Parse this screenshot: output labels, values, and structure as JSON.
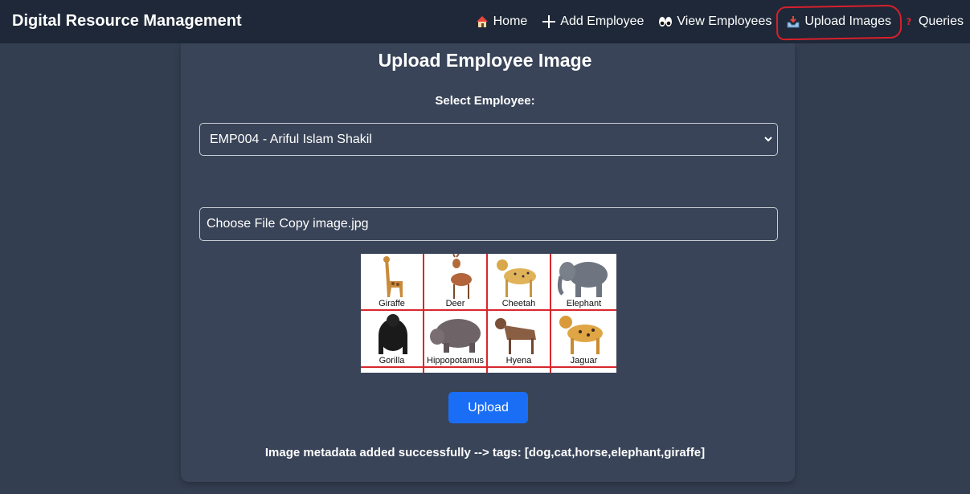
{
  "navbar": {
    "brand": "Digital Resource Management",
    "links": [
      {
        "label": "Home",
        "icon": "house-icon"
      },
      {
        "label": "Add Employee",
        "icon": "plus-icon"
      },
      {
        "label": "View Employees",
        "icon": "eyes-icon"
      },
      {
        "label": "Upload Images",
        "icon": "inbox-tray-icon",
        "active": true
      },
      {
        "label": "Queries",
        "icon": "question-icon"
      }
    ]
  },
  "form": {
    "title": "Upload Employee Image",
    "select_label": "Select Employee:",
    "selected_employee": "EMP004 - Ariful Islam Shakil",
    "file_button_label": "Choose File",
    "file_name": "Copy image.jpg",
    "upload_label": "Upload"
  },
  "preview": {
    "cells": [
      "Giraffe",
      "Deer",
      "Cheetah",
      "Elephant",
      "Gorilla",
      "Hippopotamus",
      "Hyena",
      "Jaguar"
    ]
  },
  "status": "Image metadata added successfully --> tags: [dog,cat,horse,elephant,giraffe]",
  "colors": {
    "page_bg": "#343e51",
    "navbar_bg": "#1e2838",
    "primary": "#1a6ef5",
    "annotation": "#d8202b"
  }
}
